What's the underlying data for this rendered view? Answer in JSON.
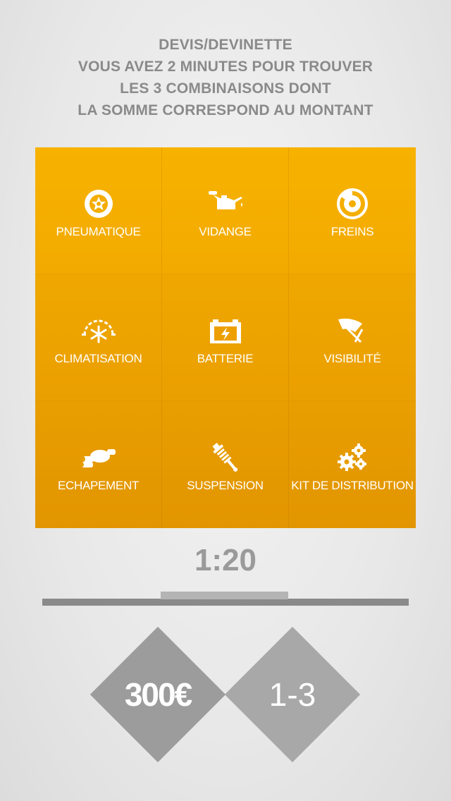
{
  "instructions": {
    "line1": "DEVIS/DEVINETTE",
    "line2": "VOUS AVEZ 2 MINUTES POUR TROUVER",
    "line3": "LES 3 COMBINAISONS DONT",
    "line4": "LA SOMME CORRESPOND AU MONTANT"
  },
  "tiles": [
    {
      "label": "PNEUMATIQUE",
      "icon": "tire-icon"
    },
    {
      "label": "VIDANGE",
      "icon": "oil-can-icon"
    },
    {
      "label": "FREINS",
      "icon": "brake-disc-icon"
    },
    {
      "label": "CLIMATISATION",
      "icon": "air-conditioning-icon"
    },
    {
      "label": "BATTERIE",
      "icon": "battery-icon"
    },
    {
      "label": "VISIBILITÉ",
      "icon": "wiper-icon"
    },
    {
      "label": "ECHAPEMENT",
      "icon": "exhaust-icon"
    },
    {
      "label": "SUSPENSION",
      "icon": "shock-absorber-icon"
    },
    {
      "label": "KIT DE DISTRIBUTION",
      "icon": "gears-icon"
    }
  ],
  "timer": "1:20",
  "amount": "300€",
  "combinations": "1-3",
  "colors": {
    "tile_orange": "#f2aa00",
    "text_gray": "#8a8a8a",
    "diamond_gray": "#a0a0a0"
  }
}
